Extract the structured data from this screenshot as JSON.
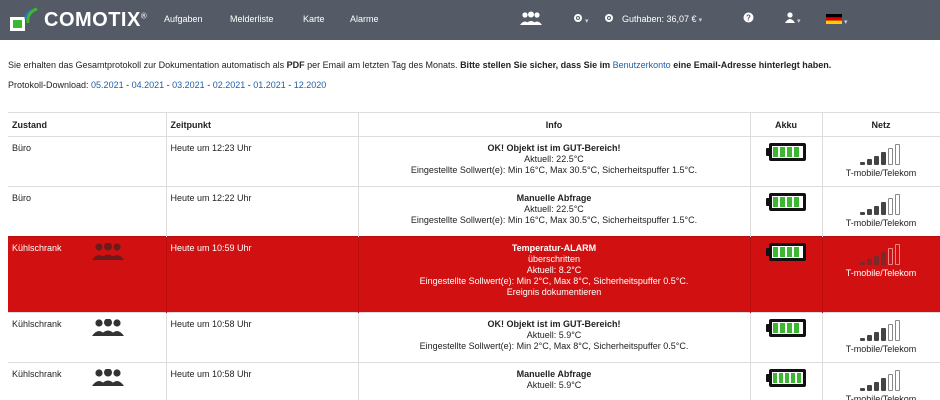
{
  "navbar": {
    "brand": "COMOTIX",
    "brand_mark": "®",
    "links": [
      "Aufgaben",
      "Melderliste",
      "Karte",
      "Alarme"
    ],
    "credit": "Guthaben: 36,07 €",
    "icons": [
      "users-icon",
      "settings-dropdown-icon",
      "settings-icon",
      "help-icon",
      "user-icon",
      "flag-de-icon"
    ]
  },
  "intro": {
    "part1": "Sie erhalten das Gesamtprotokoll zur Dokumentation automatisch als ",
    "pdf": "PDF",
    "part2": " per Email am letzten Tag des Monats. ",
    "bold1": "Bitte stellen Sie sicher, dass Sie im ",
    "link": "Benutzerkonto",
    "bold2": " eine Email-Adresse hinterlegt haben."
  },
  "downloads": {
    "label": "Protokoll-Download: ",
    "sep": " - ",
    "links": [
      "05.2021",
      "04.2021",
      "03.2021",
      "02.2021",
      "01.2021",
      "12.2020"
    ]
  },
  "table": {
    "headers": {
      "state": "Zustand",
      "time": "Zeitpunkt",
      "info": "Info",
      "battery": "Akku",
      "net": "Netz"
    },
    "rows": [
      {
        "state": "Büro",
        "group": false,
        "time": "Heute um 12:23 Uhr",
        "alarm": false,
        "info": [
          "OK! Objekt ist im GUT-Bereich!",
          "Aktuell: 22.5°C",
          "Eingestellte Sollwert(e): Min 16°C, Max 30.5°C, Sicherheitspuffer 1.5°C."
        ],
        "battery_cells": 4,
        "signal_bars": 4,
        "net": "T-mobile/Telekom"
      },
      {
        "state": "Büro",
        "group": false,
        "time": "Heute um 12:22 Uhr",
        "alarm": false,
        "info": [
          "Manuelle Abfrage",
          "Aktuell: 22.5°C",
          "Eingestellte Sollwert(e): Min 16°C, Max 30.5°C, Sicherheitspuffer 1.5°C."
        ],
        "battery_cells": 4,
        "signal_bars": 4,
        "net": "T-mobile/Telekom"
      },
      {
        "state": "Kühlschrank",
        "group": true,
        "time": "Heute um 10:59 Uhr",
        "alarm": true,
        "info": [
          "Temperatur-ALARM",
          "überschritten",
          "Aktuell: 8.2°C",
          "Eingestellte Sollwert(e): Min 2°C, Max 8°C, Sicherheitspuffer 0.5°C.",
          "Ereignis dokumentieren"
        ],
        "battery_cells": 4,
        "signal_bars": 4,
        "net": "T-mobile/Telekom"
      },
      {
        "state": "Kühlschrank",
        "group": true,
        "time": "Heute um 10:58 Uhr",
        "alarm": false,
        "info": [
          "OK! Objekt ist im GUT-Bereich!",
          "Aktuell: 5.9°C",
          "Eingestellte Sollwert(e): Min 2°C, Max 8°C, Sicherheitspuffer 0.5°C."
        ],
        "battery_cells": 4,
        "signal_bars": 4,
        "net": "T-mobile/Telekom"
      },
      {
        "state": "Kühlschrank",
        "group": true,
        "time": "Heute um 10:58 Uhr",
        "alarm": false,
        "info": [
          "Manuelle Abfrage",
          "Aktuell: 5.9°C"
        ],
        "battery_cells": 5,
        "signal_bars": 4,
        "net": "T-mobile/Telekom"
      }
    ]
  },
  "colors": {
    "navbar": "#555b66",
    "alarm_row": "#d11111",
    "link": "#1f5fa8",
    "battery_green": "#3cb731",
    "brand_green": "#3cb731",
    "brand_blue": "#2f6fd0"
  }
}
